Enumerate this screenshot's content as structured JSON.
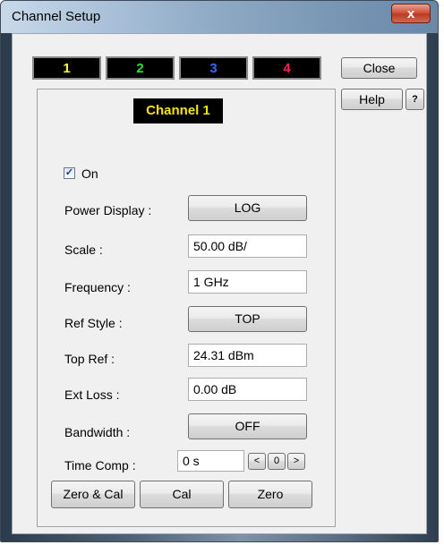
{
  "window": {
    "title": "Channel Setup",
    "close_glyph": "x"
  },
  "channel_tabs": [
    {
      "label": "1",
      "color": "#ffff33"
    },
    {
      "label": "2",
      "color": "#33dd33"
    },
    {
      "label": "3",
      "color": "#3366ff"
    },
    {
      "label": "4",
      "color": "#ff2255"
    }
  ],
  "side_buttons": {
    "close": "Close",
    "help": "Help",
    "context_help_icon": "?"
  },
  "panel": {
    "channel_label": "Channel 1",
    "on_checkbox": {
      "label": "On",
      "checked": true,
      "mark": "✓"
    },
    "power_display": {
      "label": "Power Display :",
      "value": "LOG"
    },
    "scale": {
      "label": "Scale :",
      "value": "50.00 dB/"
    },
    "frequency": {
      "label": "Frequency :",
      "value": "1 GHz"
    },
    "ref_style": {
      "label": "Ref Style :",
      "value": "TOP"
    },
    "top_ref": {
      "label": "Top Ref :",
      "value": "24.31 dBm"
    },
    "ext_loss": {
      "label": "Ext Loss :",
      "value": "0.00 dB"
    },
    "bandwidth": {
      "label": "Bandwidth :",
      "value": "OFF"
    },
    "time_comp": {
      "label": "Time Comp :",
      "value": "0 s",
      "dec": "<",
      "zero": "0",
      "inc": ">"
    },
    "actions": {
      "zero_cal": "Zero & Cal",
      "cal": "Cal",
      "zero": "Zero"
    }
  }
}
